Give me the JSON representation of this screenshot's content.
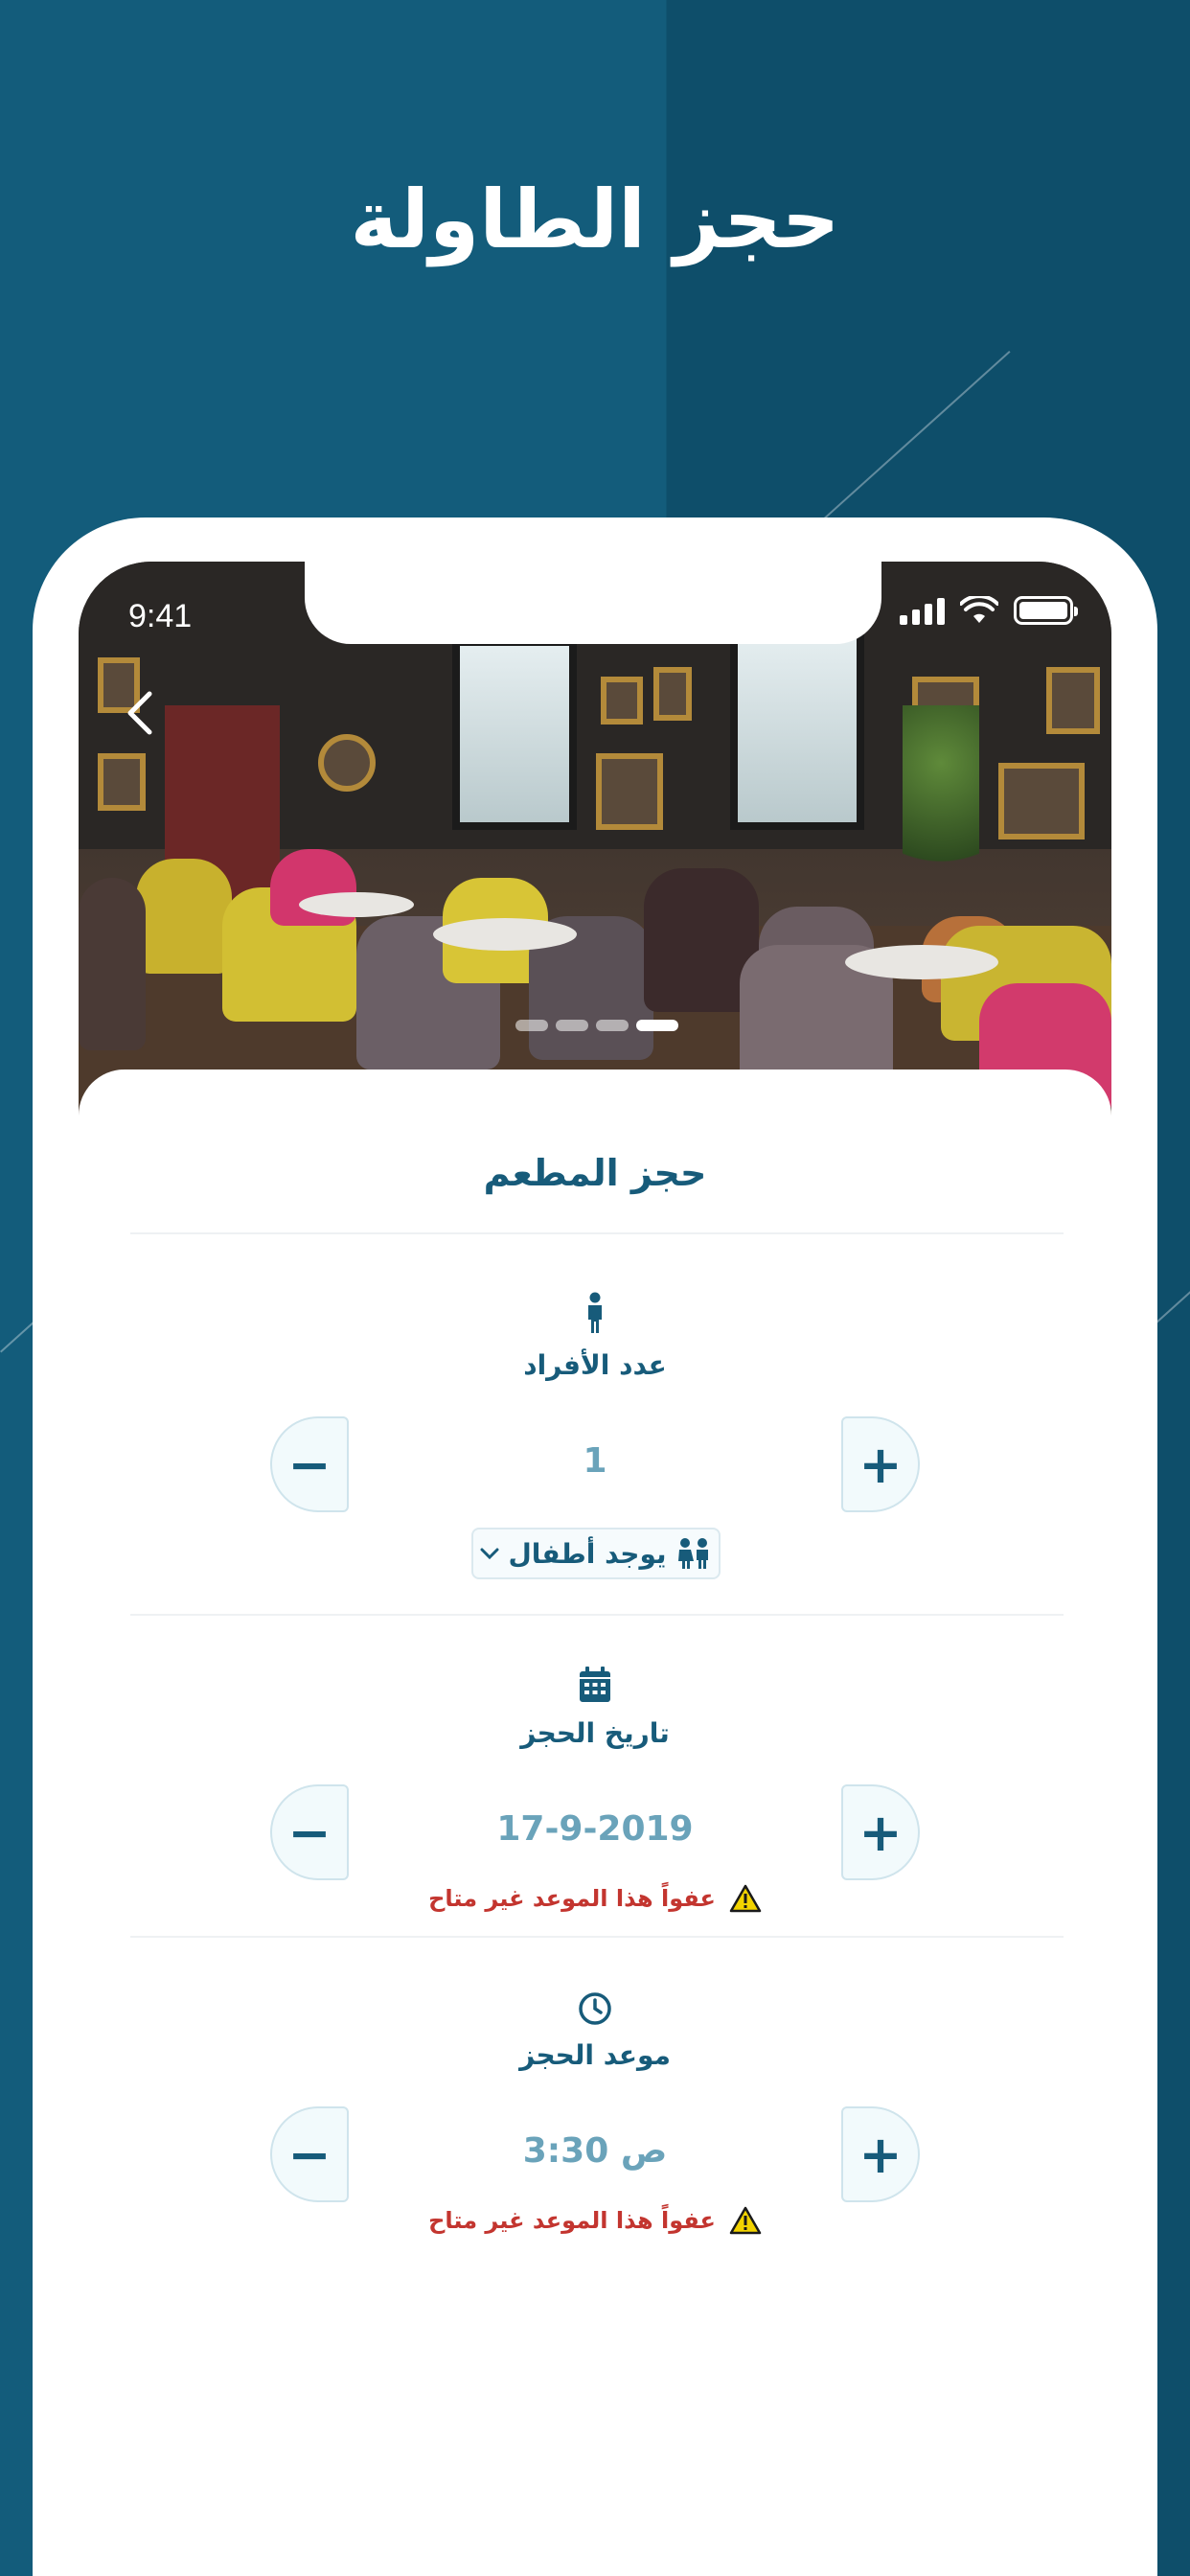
{
  "hero": {
    "title": "حجز الطاولة"
  },
  "status_bar": {
    "time": "9:41"
  },
  "photo": {
    "active_slide": 4,
    "total_slides": 4
  },
  "card": {
    "title": "حجز المطعم"
  },
  "guests": {
    "label": "عدد الأفراد",
    "value": "1",
    "minus": "−",
    "plus": "+",
    "kids_toggle": "يوجد أطفال"
  },
  "date": {
    "label": "تاريخ الحجز",
    "value": "17-9-2019",
    "minus": "−",
    "plus": "+",
    "warning": "عفواً هذا الموعد غير متاح"
  },
  "time": {
    "label": "موعد الحجز",
    "value": "3:30 ص",
    "minus": "−",
    "plus": "+",
    "warning": "عفواً هذا الموعد غير متاح"
  },
  "colors": {
    "primary": "#175b7a",
    "accent": "#6aa3ba",
    "warning": "#c3352f",
    "warning_icon": "#f2d300"
  },
  "icons": [
    "back-chevron-icon",
    "person-icon",
    "kids-icon",
    "chevron-down-icon",
    "calendar-icon",
    "clock-icon",
    "warning-icon",
    "signal-icon",
    "wifi-icon",
    "battery-icon"
  ]
}
